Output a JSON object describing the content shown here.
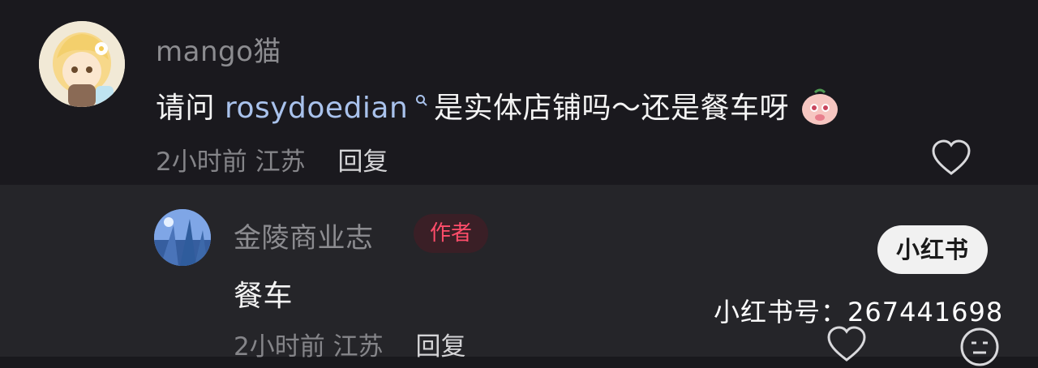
{
  "comment": {
    "username": "mango猫",
    "text_prefix": "请问 ",
    "mention": "rosydoedian",
    "text_suffix": " 是实体店铺吗～还是餐车呀",
    "emoji": "blushing-face-sticker",
    "time": "2小时前",
    "location": "江苏",
    "reply_label": "回复"
  },
  "reply": {
    "username": "金陵商业志",
    "badge": "作者",
    "text": "餐车",
    "time": "2小时前",
    "location": "江苏",
    "reply_label": "回复"
  },
  "watermark": {
    "logo": "小红书",
    "id_text": "小红书号：267441698"
  },
  "icons": {
    "like": "heart-outline-icon",
    "emoji": "neutral-face-icon",
    "mention_search": "search-icon"
  },
  "colors": {
    "background": "#19191d",
    "reply_background": "#252529",
    "author_badge": "#ff4d6a",
    "mention": "#a9c2ec"
  }
}
